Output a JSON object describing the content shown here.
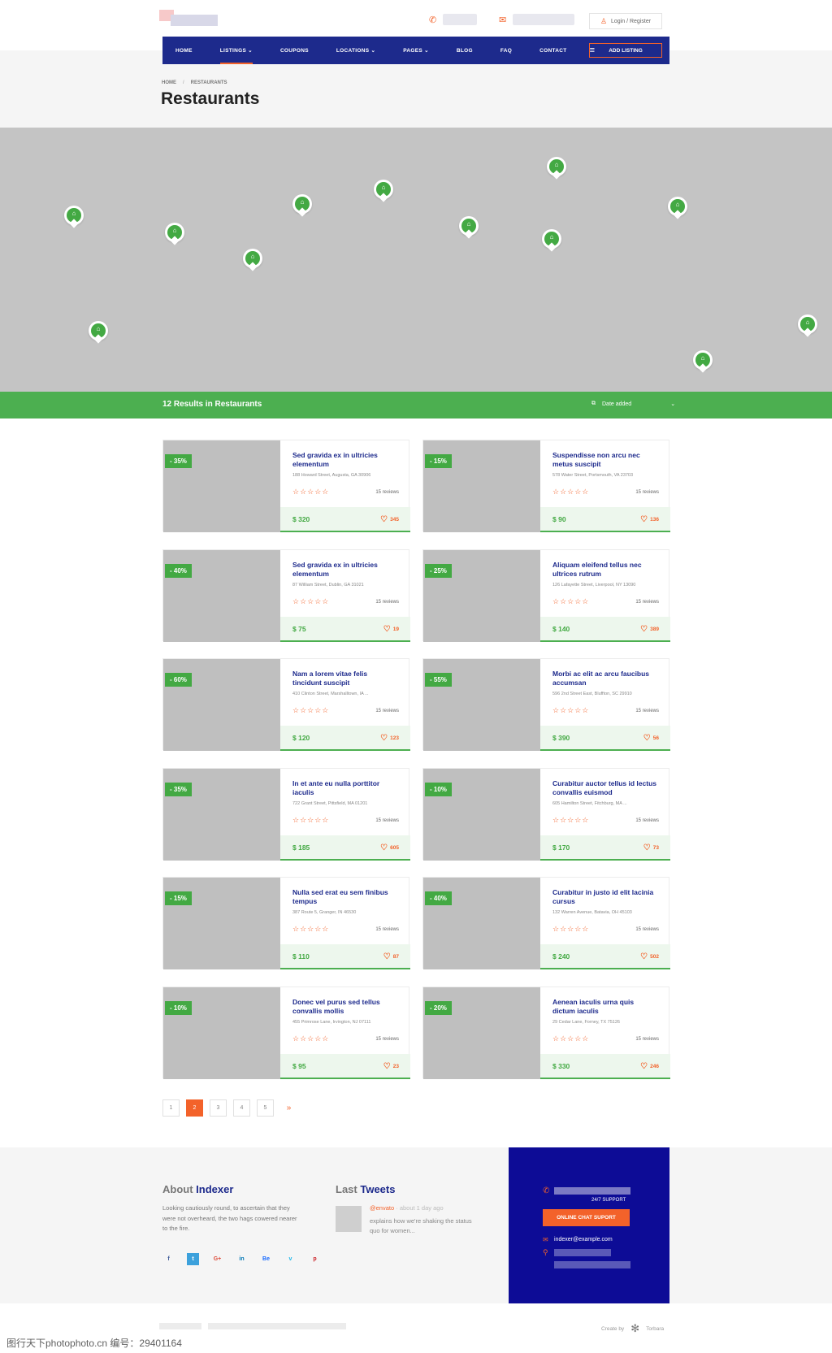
{
  "header": {
    "login_label": "Login / Register",
    "phone_icon": "phone-icon",
    "mail_icon": "mail-icon"
  },
  "nav": {
    "items": [
      {
        "label": "HOME"
      },
      {
        "label": "LISTINGS ⌄"
      },
      {
        "label": "COUPONS"
      },
      {
        "label": "LOCATIONS ⌄"
      },
      {
        "label": "PAGES ⌄"
      },
      {
        "label": "BLOG"
      },
      {
        "label": "FAQ"
      },
      {
        "label": "CONTACT"
      }
    ],
    "add_listing": "ADD LISTING"
  },
  "breadcrumb": {
    "home": "HOME",
    "current": "RESTAURANTS"
  },
  "page_title": "Restaurants",
  "results": {
    "title": "12 Results in Restaurants",
    "sort_label": "Date added"
  },
  "listings": [
    {
      "badge": "- 35%",
      "title": "Sed gravida ex in ultricies elementum",
      "address": "188 Howard Street, Augusta, GA 30906",
      "reviews": "15 reviews",
      "price": "$ 320",
      "likes": "345"
    },
    {
      "badge": "- 15%",
      "title": "Suspendisse non arcu nec metus suscipit",
      "address": "578 Water Street, Portsmouth, VA 23703",
      "reviews": "15 reviews",
      "price": "$ 90",
      "likes": "136"
    },
    {
      "badge": "- 40%",
      "title": "Sed gravida ex in ultricies elementum",
      "address": "87 William Street, Dublin, GA 31021",
      "reviews": "15 reviews",
      "price": "$ 75",
      "likes": "19"
    },
    {
      "badge": "- 25%",
      "title": "Aliquam eleifend tellus nec ultrices rutrum",
      "address": "126 Lafayette Street, Liverpool, NY 13090",
      "reviews": "15 reviews",
      "price": "$ 140",
      "likes": "389"
    },
    {
      "badge": "- 60%",
      "title": "Nam a lorem vitae felis tincidunt suscipit",
      "address": "410 Clinton Street, Marshalltown, IA ...",
      "reviews": "15 reviews",
      "price": "$ 120",
      "likes": "123"
    },
    {
      "badge": "- 55%",
      "title": "Morbi ac elit ac arcu faucibus accumsan",
      "address": "596 2nd Street East, Bluffton, SC 29910",
      "reviews": "15 reviews",
      "price": "$ 390",
      "likes": "56"
    },
    {
      "badge": "- 35%",
      "title": "In et ante eu nulla porttitor iaculis",
      "address": "722 Grant Street, Pittsfield, MA 01201",
      "reviews": "15 reviews",
      "price": "$ 185",
      "likes": "605"
    },
    {
      "badge": "- 10%",
      "title": "Curabitur auctor tellus id lectus convallis euismod",
      "address": "605 Hamilton Street, Fitchburg, MA ...",
      "reviews": "15 reviews",
      "price": "$ 170",
      "likes": "73"
    },
    {
      "badge": "- 15%",
      "title": "Nulla sed erat eu sem finibus tempus",
      "address": "387 Route 5, Granger, IN 46530",
      "reviews": "15 reviews",
      "price": "$ 110",
      "likes": "87"
    },
    {
      "badge": "- 40%",
      "title": "Curabitur in justo id elit lacinia cursus",
      "address": "132 Warren Avenue, Batavia, OH 45103",
      "reviews": "15 reviews",
      "price": "$ 240",
      "likes": "502"
    },
    {
      "badge": "- 10%",
      "title": "Donec vel purus sed tellus convallis mollis",
      "address": "455 Primrose Lane, Irvington, NJ 07111",
      "reviews": "15 reviews",
      "price": "$ 95",
      "likes": "23"
    },
    {
      "badge": "- 20%",
      "title": "Aenean iaculis urna quis dictum iaculis",
      "address": "29 Cedar Lane, Forney, TX 75126",
      "reviews": "15 reviews",
      "price": "$ 330",
      "likes": "246"
    }
  ],
  "rating_stars": "☆☆☆☆☆",
  "pagination": {
    "pages": [
      "1",
      "2",
      "3",
      "4",
      "5"
    ],
    "current": "2",
    "next": "»"
  },
  "footer": {
    "about_prefix": "About",
    "about_name": "Indexer",
    "about_text": "Looking cautiously round, to ascertain that they were not overheard, the two hags cowered nearer to the fire.",
    "socials": [
      "f",
      "t",
      "G+",
      "in",
      "Be",
      "v",
      "p"
    ],
    "tweets_prefix": "Last",
    "tweets_name": "Tweets",
    "tweet_handle": "@envato",
    "tweet_time": "about 1 day ago",
    "tweet_text": "explains how we're shaking the status quo for women...",
    "support_label": "24/7 SUPPORT",
    "chat_button": "ONLINE CHAT SUPORT",
    "email": "indexer@example.com",
    "created_by": "Create by",
    "creator": "Torbara"
  },
  "watermark": "图行天下photophoto.cn  编号：29401164",
  "colors": {
    "primary": "#1d2a8c",
    "accent": "#f3622a",
    "green": "#4caf50",
    "support_bg": "#0d0c96"
  }
}
